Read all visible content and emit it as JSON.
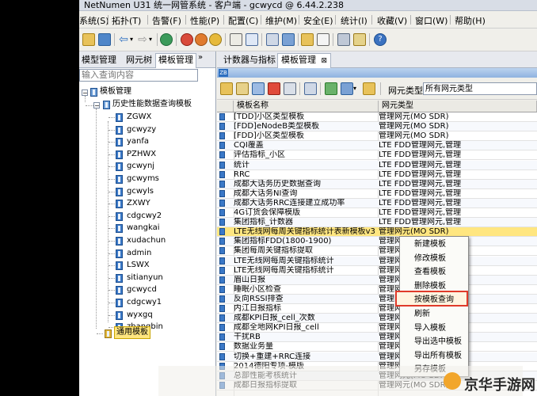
{
  "window": {
    "title": "NetNumen U31 统一网管系统 - 客户端 - gcwycd @ 6.44.2.238"
  },
  "menu": [
    {
      "label": "系统(S)"
    },
    {
      "label": "拓扑(T)"
    },
    {
      "label": "告警(F)"
    },
    {
      "label": "性能(P)"
    },
    {
      "label": "配置(C)"
    },
    {
      "label": "维护(M)"
    },
    {
      "label": "安全(E)"
    },
    {
      "label": "统计(I)"
    },
    {
      "label": "收藏(V)"
    },
    {
      "label": "窗口(W)"
    },
    {
      "label": "帮助(H)"
    }
  ],
  "left_panel": {
    "tabs": [
      {
        "label": "模型管理"
      },
      {
        "label": "网元树"
      },
      {
        "label": "模板管理"
      }
    ],
    "search_placeholder": "输入查询内容",
    "tree": {
      "root": "模板管理",
      "group": "历史性能数据查询模板",
      "children": [
        "ZGWX",
        "gcwyzy",
        "yanfa",
        "PZHWX",
        "gcwynj",
        "gcwyms",
        "gcwyls",
        "ZXWY",
        "cdgcwy2",
        "wangkai",
        "xudachun",
        "admin",
        "LSWX",
        "sitianyun",
        "gcwycd",
        "cdgcwy1",
        "wyxgq",
        "zhangbin"
      ],
      "selected": "通用模板"
    }
  },
  "right_panel": {
    "tabs": [
      {
        "label": "计数器与指标"
      },
      {
        "label": "模板管理"
      }
    ],
    "filter_label": "网元类型:",
    "filter_value": "所有网元类型",
    "columns": [
      "模板名称",
      "网元类型"
    ],
    "rows": [
      {
        "name": "[TDD]小区类型模板",
        "type": "管理网元(MO SDR)"
      },
      {
        "name": "[FDD]eNodeB类型模板",
        "type": "管理网元(MO SDR)"
      },
      {
        "name": "[FDD]小区类型模板",
        "type": "管理网元(MO SDR)"
      },
      {
        "name": "CQI覆盖",
        "type": "LTE FDD管理网元,管理"
      },
      {
        "name": "评估指标_小区",
        "type": "LTE FDD管理网元,管理"
      },
      {
        "name": "统计",
        "type": "LTE FDD管理网元,管理"
      },
      {
        "name": "RRC",
        "type": "LTE FDD管理网元,管理"
      },
      {
        "name": "成都大话务历史数据查询",
        "type": "LTE FDD管理网元,管理"
      },
      {
        "name": "成都大话务NI查询",
        "type": "LTE FDD管理网元,管理"
      },
      {
        "name": "成都大话务RRC连接建立成功率",
        "type": "LTE FDD管理网元,管理"
      },
      {
        "name": "4G订货会保障模版",
        "type": "LTE FDD管理网元,管理"
      },
      {
        "name": "集团指标_计数器",
        "type": "LTE FDD管理网元,管理"
      },
      {
        "name": "LTE无线网每周关键指标统计表新模板v3",
        "type": "管理网元(MO SDR)"
      },
      {
        "name": "集团指标FDD(1800-1900)",
        "type": "管理网元(MO SDR)"
      },
      {
        "name": "集团每周关键指标提取",
        "type": "管理网元(MO SDR)"
      },
      {
        "name": "LTE无线网每周关键指标统计",
        "type": "管理网元(MO SDR)"
      },
      {
        "name": "LTE无线网每周关键指标统计",
        "type": "管理网元(MO SDR)"
      },
      {
        "name": "眉山日报",
        "type": "管理网元(MO SDR)"
      },
      {
        "name": "睡眠小区检查",
        "type": "管理网元(MO SDR)"
      },
      {
        "name": "反向RSSI排查",
        "type": "管理网元(MO SDR)"
      },
      {
        "name": "内江日报指标",
        "type": "管理网元(MO SDR)"
      },
      {
        "name": "成都KPI日报_cell_次数",
        "type": "管理网元(MO SDR)"
      },
      {
        "name": "成都全地网KPI日报_cell",
        "type": "管理网元(MO SDR)"
      },
      {
        "name": "干扰RB",
        "type": "管理网元(MO SDR)"
      },
      {
        "name": "数据业务量",
        "type": "管理网元(MO SDR)"
      },
      {
        "name": "切换+重建+RRC连接",
        "type": "管理网元(MO SDR)"
      },
      {
        "name": "2014德阳专项-模版",
        "type": "管理网元(MO SDR)"
      },
      {
        "name": "总部性能考核统计",
        "type": "管理网元(MO SDR)"
      },
      {
        "name": "成都日报指标提取",
        "type": "管理网元(MO SDR)"
      }
    ],
    "selected_row": 12
  },
  "context_menu": {
    "items": [
      "新建模板",
      "修改模板",
      "查看模板",
      "删除模板",
      "按模板查询",
      "刷新",
      "导入模板",
      "导出选中模板",
      "导出所有模板",
      "另存模板"
    ],
    "highlighted": 4
  },
  "watermark": "京华手游网",
  "colors": {
    "selection": "#ffe680",
    "highlight_border": "#e03a2a",
    "icon_blue": "#3a78c7"
  }
}
